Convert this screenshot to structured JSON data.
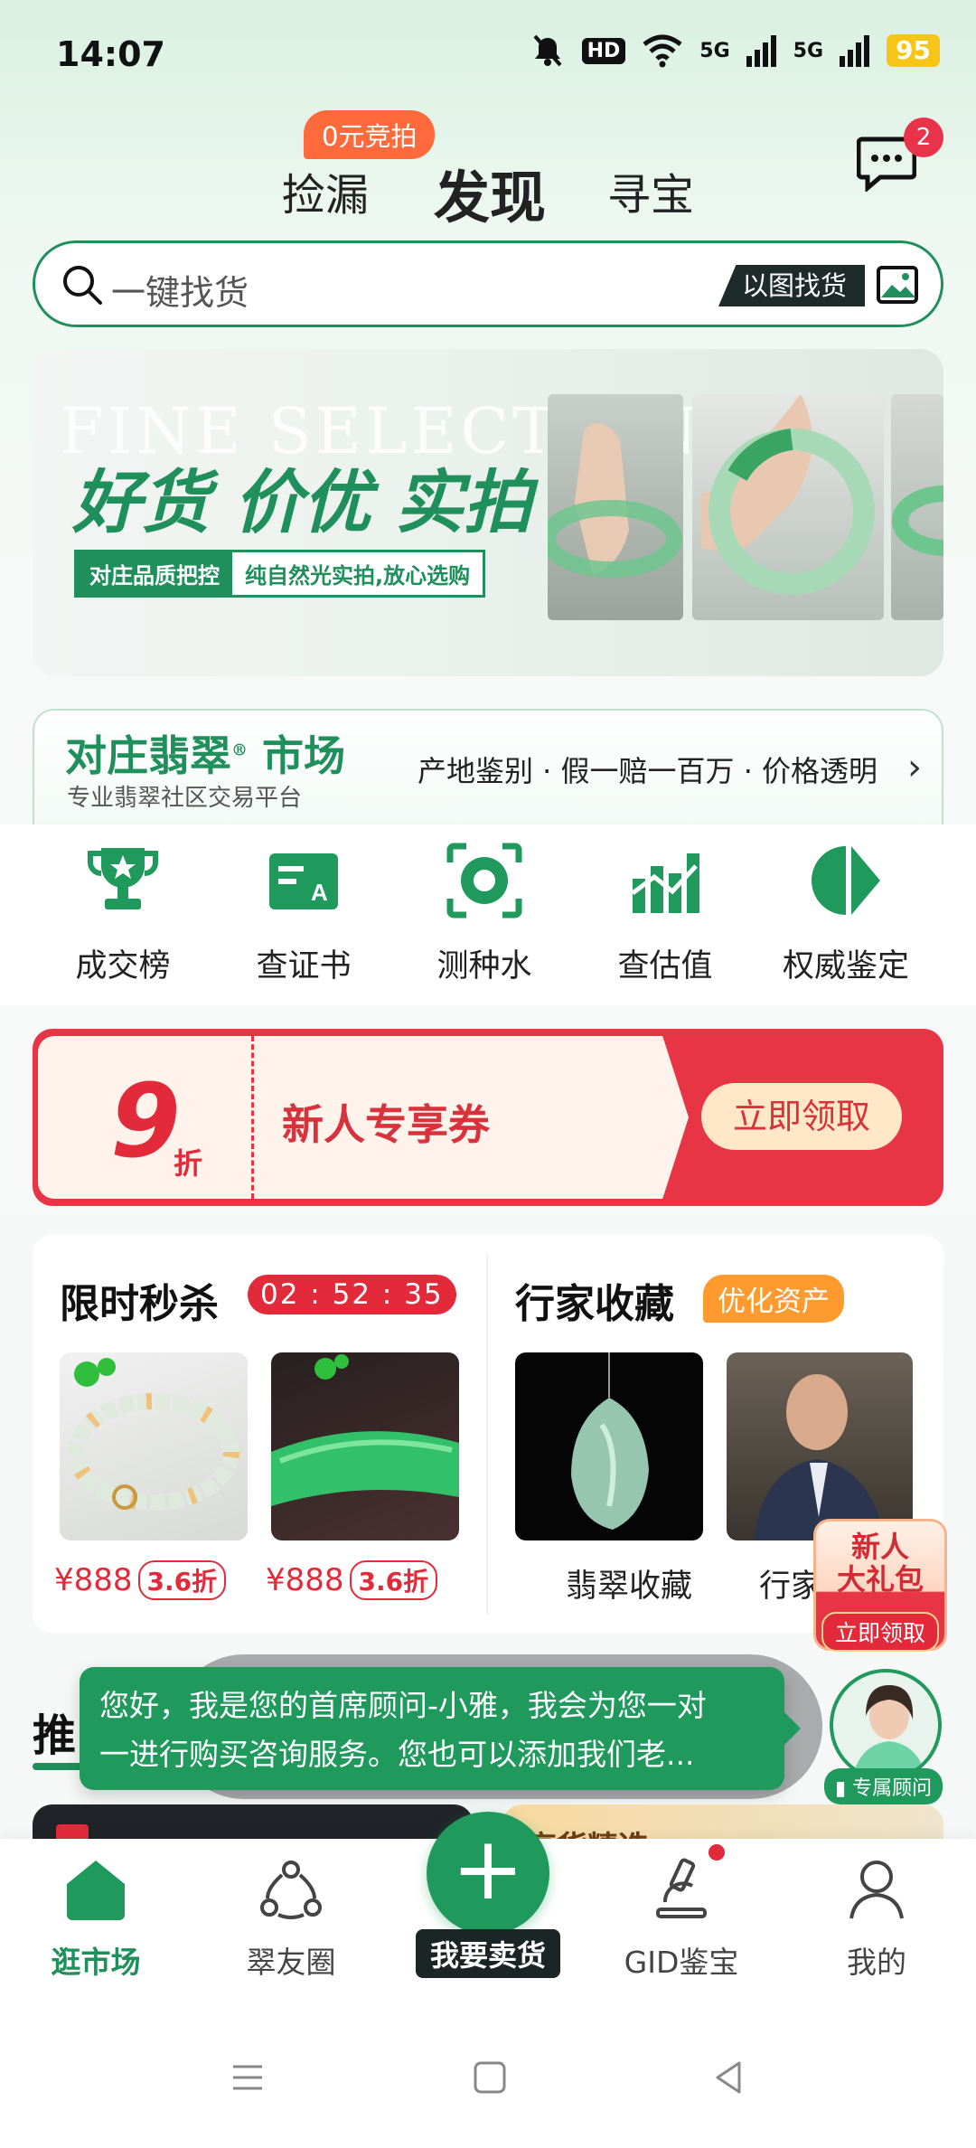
{
  "status_bar": {
    "time": "14:07",
    "network_1": "5G",
    "network_2": "5G",
    "hd_label": "HD",
    "battery": "95"
  },
  "top_tabs": {
    "tab_bargain": "捡漏",
    "tab_discover": "发现",
    "tab_treasure": "寻宝",
    "auction_badge": "0元竞拍",
    "message_count": "2"
  },
  "search": {
    "placeholder": "一键找货",
    "image_search_label": "以图找货"
  },
  "banner": {
    "ghost_text": "FINE SELECTION",
    "headline": "好货 价优 实拍",
    "tag_quality": "对庄品质把控",
    "tag_natural": "纯自然光实拍,放心选购"
  },
  "market": {
    "title": "对庄翡翠",
    "title_mark": "®",
    "title_suffix": "市场",
    "subtitle": "专业翡翠社区交易平台",
    "features_text": "产地鉴别 · 假一赔一百万 · 价格透明"
  },
  "features": [
    {
      "label": "成交榜",
      "icon": "trophy-icon"
    },
    {
      "label": "查证书",
      "icon": "certificate-icon"
    },
    {
      "label": "测种水",
      "icon": "scan-icon"
    },
    {
      "label": "查估值",
      "icon": "chart-icon"
    },
    {
      "label": "权威鉴定",
      "icon": "appraise-icon"
    }
  ],
  "coupon": {
    "discount": "9",
    "discount_unit": "折",
    "title": "新人专享券",
    "button": "立即领取"
  },
  "flash_sale": {
    "title": "限时秒杀",
    "timer": "02 : 52 : 35",
    "items": [
      {
        "price": "¥888",
        "discount": "3.6折"
      },
      {
        "price": "¥888",
        "discount": "3.6折"
      }
    ]
  },
  "collection": {
    "title": "行家收藏",
    "tag": "优化资产",
    "items": [
      {
        "label": "翡翠收藏"
      },
      {
        "label": "行家"
      }
    ]
  },
  "gift": {
    "line1": "新人",
    "line2": "大礼包",
    "button": "立即领取"
  },
  "recommend": {
    "tab": "推"
  },
  "chat_bubble": {
    "line1": "您好，我是您的首席顾问-小雅，我会为您一对",
    "line2": "一进行购买咨询服务。您也可以添加我们老..."
  },
  "advisor_tag": "专属顾问",
  "feed": {
    "gold_card_text": "高货精选"
  },
  "bottom_nav": {
    "market": "逛市场",
    "circle": "翠友圈",
    "sell": "我要卖货",
    "gid": "GID鉴宝",
    "mine": "我的"
  },
  "colors": {
    "brand_green": "#1f8f5c",
    "accent_red": "#e22a3a",
    "accent_orange": "#ff6a3d"
  }
}
